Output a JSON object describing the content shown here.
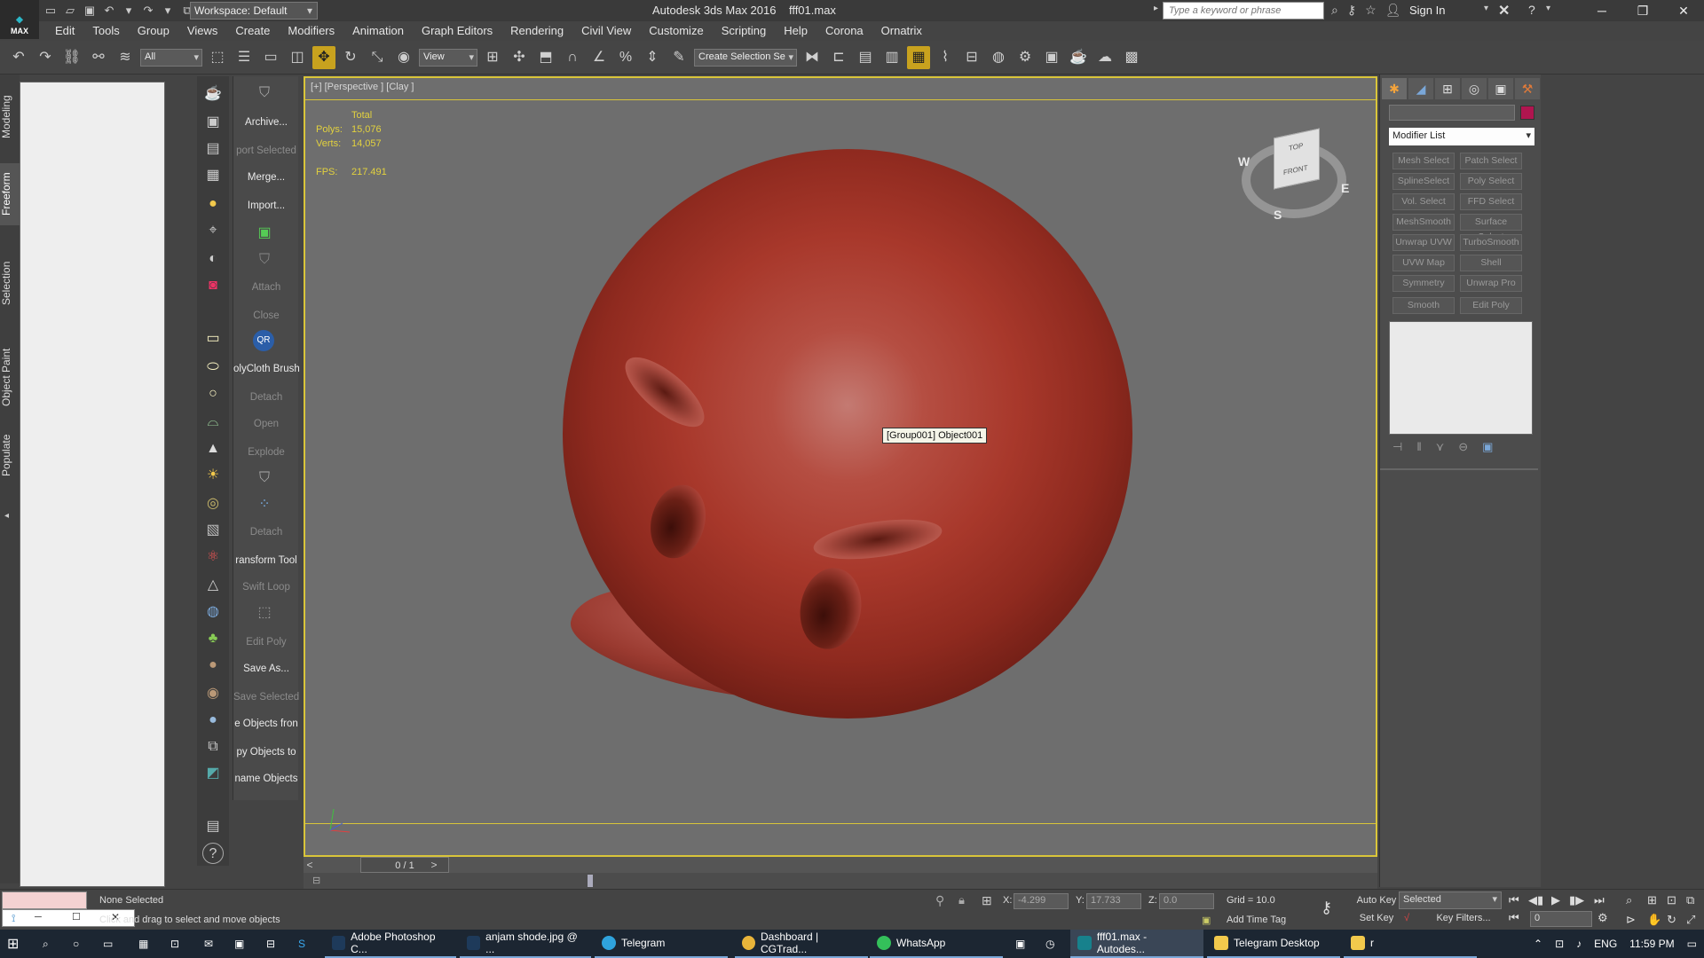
{
  "title": {
    "app": "Autodesk 3ds Max 2016",
    "file": "fff01.max"
  },
  "workspace": "Workspace: Default",
  "search": {
    "placeholder": "Type a keyword or phrase"
  },
  "signin": "Sign In",
  "menu": [
    "Edit",
    "Tools",
    "Group",
    "Views",
    "Create",
    "Modifiers",
    "Animation",
    "Graph Editors",
    "Rendering",
    "Civil View",
    "Customize",
    "Scripting",
    "Help",
    "Corona",
    "Ornatrix"
  ],
  "toolbar": {
    "filter": "All",
    "refcoord": "View",
    "selset": "Create Selection Se"
  },
  "ribbon_tabs": [
    "Modeling",
    "Freeform",
    "Selection",
    "Object Paint",
    "Populate"
  ],
  "script_panel": [
    {
      "label": "Archive...",
      "state": "lit"
    },
    {
      "label": "port Selected",
      "state": "dim"
    },
    {
      "label": "Merge...",
      "state": "lit"
    },
    {
      "label": "Import...",
      "state": "lit"
    },
    {
      "label": "Attach",
      "state": "dim"
    },
    {
      "label": "Close",
      "state": "dim"
    },
    {
      "label": "olyCloth Brush",
      "state": "lit"
    },
    {
      "label": "Detach",
      "state": "dim"
    },
    {
      "label": "Open",
      "state": "dim"
    },
    {
      "label": "Explode",
      "state": "dim"
    },
    {
      "label": "Detach",
      "state": "dim"
    },
    {
      "label": "ransform Tool",
      "state": "lit"
    },
    {
      "label": "Swift Loop",
      "state": "dim"
    },
    {
      "label": "Edit Poly",
      "state": "dim"
    },
    {
      "label": "Save As...",
      "state": "lit"
    },
    {
      "label": "Save Selected",
      "state": "dim"
    },
    {
      "label": "e Objects fron",
      "state": "lit"
    },
    {
      "label": "py Objects to",
      "state": "lit"
    },
    {
      "label": "name Objects",
      "state": "lit"
    }
  ],
  "viewport": {
    "label": "[+] [Perspective ] [Clay ]",
    "stats": {
      "header": "Total",
      "polys_label": "Polys:",
      "polys": "15,076",
      "verts_label": "Verts:",
      "verts": "14,057",
      "fps_label": "FPS:",
      "fps": "217.491"
    },
    "tooltip": "[Group001] Object001",
    "viewcube": {
      "top": "TOP",
      "front": "FRONT",
      "w": "W",
      "e": "E",
      "s": "S"
    }
  },
  "timeline": {
    "frame": "0 / 1"
  },
  "command_panel": {
    "modifier_list": "Modifier List",
    "accent": "#b0154f",
    "buttons": [
      "Mesh Select",
      "Patch Select",
      "SplineSelect",
      "Poly Select",
      "Vol. Select",
      "FFD Select",
      "MeshSmooth",
      "Surface Select",
      "Unwrap UVW",
      "TurboSmooth",
      "UVW Map",
      "Shell",
      "Symmetry",
      "Unwrap Pro",
      "Smooth",
      "Edit Poly"
    ]
  },
  "status": {
    "selection": "None Selected",
    "prompt": "Click and drag to select and move objects",
    "x_label": "X:",
    "x": "-4.299",
    "y_label": "Y:",
    "y": "17.733",
    "z_label": "Z:",
    "z": "0.0",
    "grid": "Grid = 10.0",
    "add_time_tag": "Add Time Tag",
    "auto_key": "Auto Key",
    "set_key": "Set Key",
    "selected": "Selected",
    "key_filters": "Key Filters...",
    "frame": "0"
  },
  "taskbar": {
    "apps": [
      "Adobe Photoshop C...",
      "anjam shode.jpg @ ...",
      "Telegram",
      "Dashboard | CGTrad...",
      "WhatsApp",
      "fff01.max - Autodes...",
      "Telegram Desktop",
      "r"
    ],
    "lang": "ENG",
    "time": "11:59 PM"
  }
}
